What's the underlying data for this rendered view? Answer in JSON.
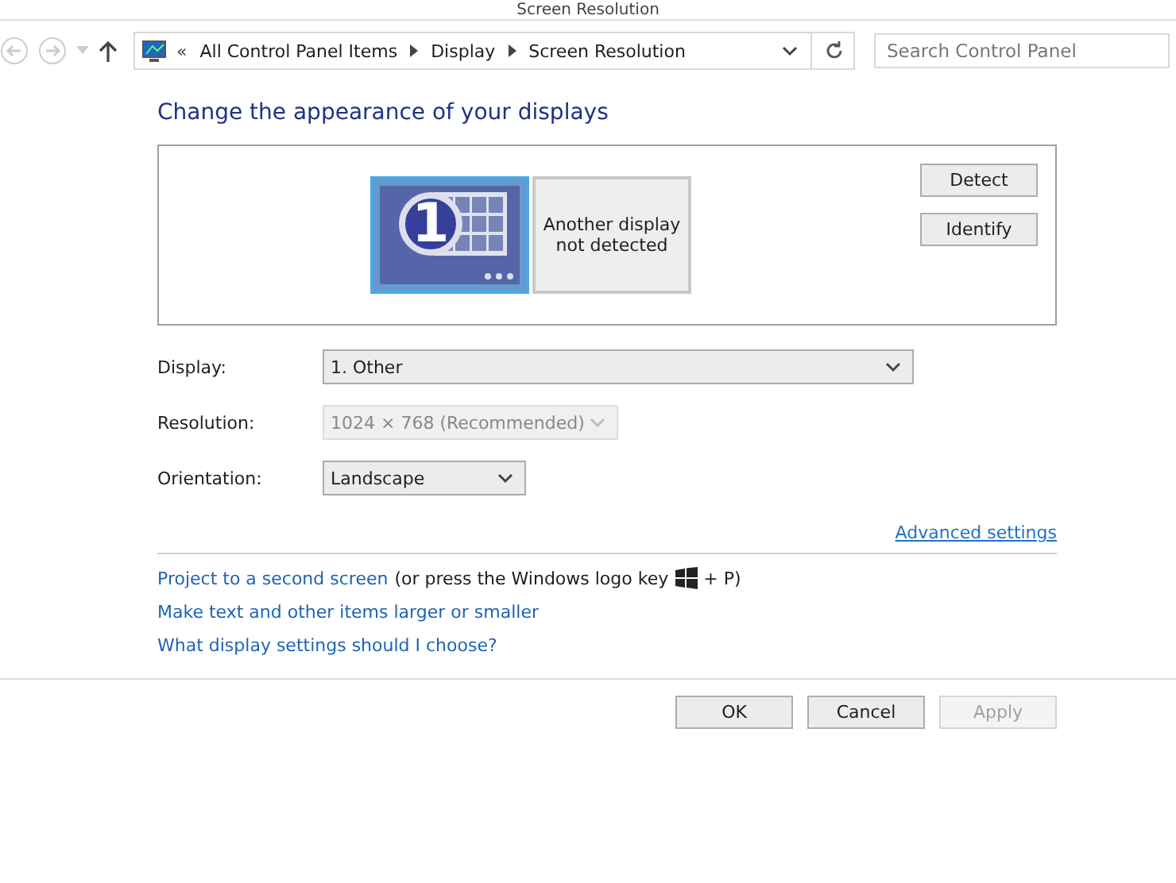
{
  "window": {
    "title": "Screen Resolution"
  },
  "address_bar": {
    "overflow": "«",
    "crumbs": [
      "All Control Panel Items",
      "Display",
      "Screen Resolution"
    ]
  },
  "search": {
    "placeholder": "Search Control Panel"
  },
  "heading": "Change the appearance of your displays",
  "monitors": [
    {
      "kind": "primary",
      "number": "1",
      "selected": true
    },
    {
      "kind": "missing",
      "label": "Another display not detected",
      "selected": false
    }
  ],
  "side_buttons": [
    "Detect",
    "Identify"
  ],
  "fields": [
    {
      "label": "Display:",
      "value": "1. Other",
      "disabled": false
    },
    {
      "label": "Resolution:",
      "value": "1024 × 768 (Recommended)",
      "disabled": true
    },
    {
      "label": "Orientation:",
      "value": "Landscape",
      "disabled": false
    }
  ],
  "advanced_link": "Advanced settings",
  "links": [
    {
      "text": "Project to a second screen",
      "note_before": "(or press the Windows logo key",
      "note_after": "+ P)"
    },
    {
      "text": "Make text and other items larger or smaller"
    },
    {
      "text": "What display settings should I choose?"
    }
  ],
  "buttons": [
    {
      "label": "OK",
      "disabled": false
    },
    {
      "label": "Cancel",
      "disabled": false
    },
    {
      "label": "Apply",
      "disabled": true
    }
  ]
}
